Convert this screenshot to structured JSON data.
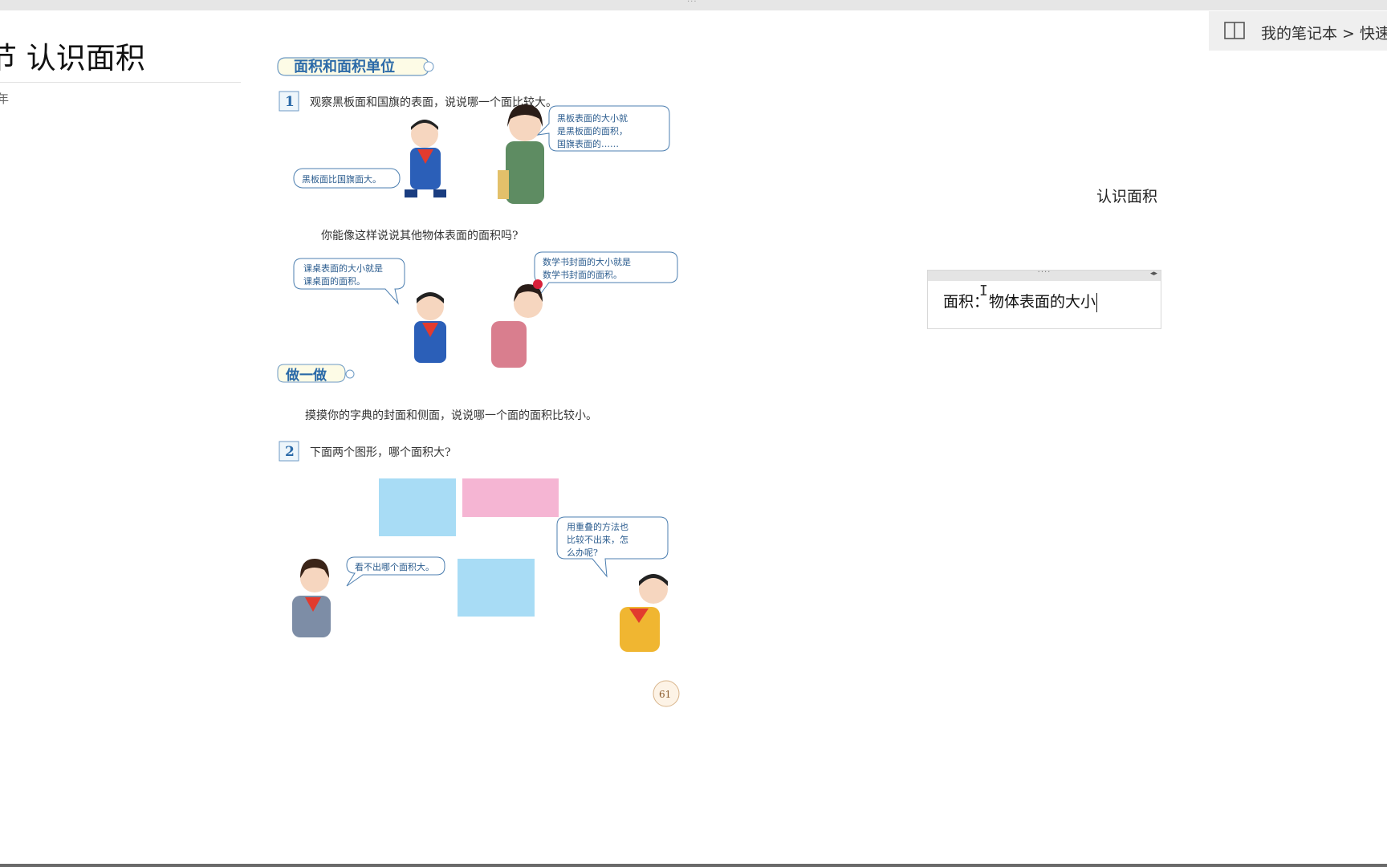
{
  "breadcrumb": {
    "path": "我的笔记本 > 快速"
  },
  "page": {
    "title": "节 认识面积",
    "meta": "年"
  },
  "textbook": {
    "section_title": "面积和面积单位",
    "q1_number": "1",
    "q1_text": "观察黑板面和国旗的表面，说说哪一个面比较大。",
    "bubble_boy1": "黑板面比国旗面大。",
    "bubble_teacher": [
      "黑板表面的大小就",
      "是黑板面的面积，",
      "国旗表面的……"
    ],
    "prompt_text": "你能像这样说说其他物体表面的面积吗?",
    "bubble_boy2": [
      "课桌表面的大小就是",
      "课桌面的面积。"
    ],
    "bubble_girl1": [
      "数学书封面的大小就是",
      "数学书封面的面积。"
    ],
    "do_title": "做一做",
    "do_text": "摸摸你的字典的封面和侧面，说说哪一个面的面积比较小。",
    "q2_number": "2",
    "q2_text": "下面两个图形，哪个面积大?",
    "bubble_girl2": "看不出哪个面积大。",
    "bubble_boy3": [
      "用重叠的方法也",
      "比较不出来，怎",
      "么办呢?"
    ],
    "page_number": "61"
  },
  "outline": {
    "text": "认识面积"
  },
  "note": {
    "text": "面积：物体表面的大小"
  },
  "colors": {
    "blue_shape": "#a8dcf5",
    "pink_shape": "#f5b5d3",
    "bubble_stroke": "#4d7fb0",
    "page_text": "#333333"
  }
}
